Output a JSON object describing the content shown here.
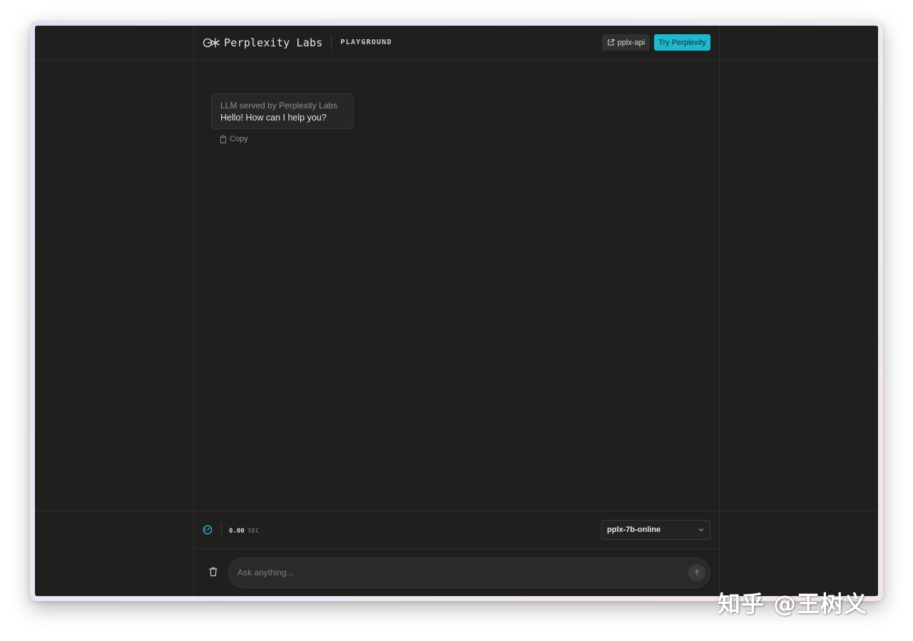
{
  "header": {
    "brand": "Perplexity Labs",
    "product": "PLAYGROUND",
    "api_button_label": "pplx-api",
    "try_button_label": "Try Perplexity"
  },
  "chat": {
    "messages": [
      {
        "sender": "LLM served by Perplexity Labs",
        "text": "Hello! How can I help you?"
      }
    ],
    "copy_label": "Copy"
  },
  "status": {
    "elapsed": "0.00",
    "elapsed_unit": "SEC",
    "model": "pplx-7b-online"
  },
  "input": {
    "placeholder": "Ask anything..."
  },
  "watermark": "知乎 @王树义",
  "colors": {
    "background": "#1f201e",
    "accent": "#20b8cd",
    "border": "#2f302e"
  },
  "icons": [
    "perplexity-logo-icon",
    "external-link-icon",
    "clipboard-icon",
    "speedometer-icon",
    "chevron-down-icon",
    "trash-icon",
    "arrow-up-icon"
  ]
}
